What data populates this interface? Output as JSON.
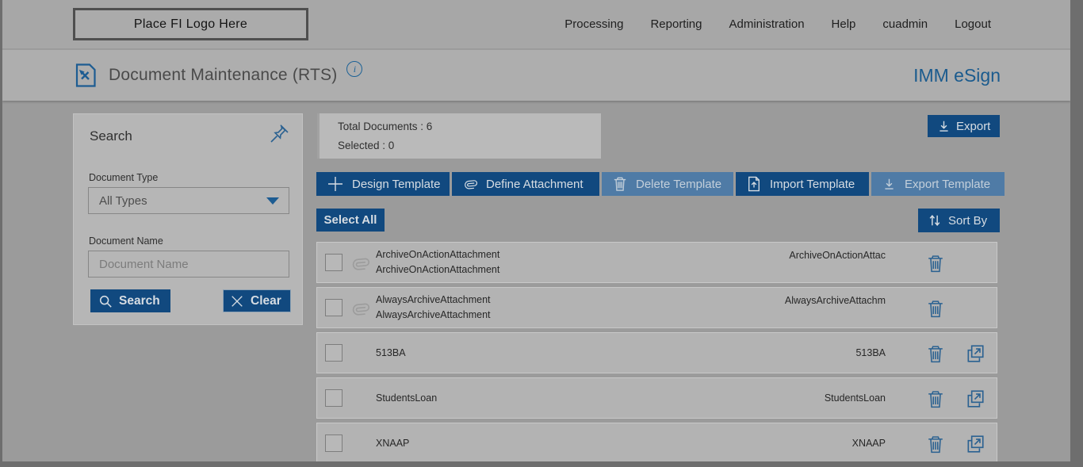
{
  "header": {
    "logo_placeholder": "Place FI Logo Here",
    "nav": [
      {
        "label": "Processing"
      },
      {
        "label": "Reporting"
      },
      {
        "label": "Administration"
      },
      {
        "label": "Help"
      },
      {
        "label": "cuadmin"
      },
      {
        "label": "Logout"
      }
    ]
  },
  "titlebar": {
    "title": "Document Maintenance (RTS)",
    "info_glyph": "i",
    "brand": "IMM eSign"
  },
  "search_panel": {
    "title": "Search",
    "document_type_label": "Document Type",
    "document_type_value": "All Types",
    "document_name_label": "Document Name",
    "document_name_placeholder": "Document Name",
    "document_name_value": "",
    "search_button": "Search",
    "clear_button": "Clear"
  },
  "summary": {
    "total_documents": "Total Documents : 6",
    "selected": "Selected : 0"
  },
  "actions": {
    "export_label": "Export",
    "select_all_label": "Select All",
    "sort_by_label": "Sort By",
    "toolbar": [
      {
        "label": "Design Template",
        "icon": "plus-icon",
        "enabled": true
      },
      {
        "label": "Define Attachment",
        "icon": "paperclip-icon",
        "enabled": true
      },
      {
        "label": "Delete Template",
        "icon": "trash-icon",
        "enabled": false
      },
      {
        "label": "Import Template",
        "icon": "import-icon",
        "enabled": true
      },
      {
        "label": "Export Template",
        "icon": "download-icon",
        "enabled": false
      }
    ]
  },
  "documents": {
    "rows": [
      {
        "name": "ArchiveOnActionAttachment",
        "subname": "ArchiveOnActionAttachment",
        "right_name": "ArchiveOnActionAttac",
        "attachment": true,
        "actions": [
          "delete"
        ]
      },
      {
        "name": "AlwaysArchiveAttachment",
        "subname": "AlwaysArchiveAttachment",
        "right_name": "AlwaysArchiveAttachm",
        "attachment": true,
        "actions": [
          "delete"
        ]
      },
      {
        "name": "513BA",
        "right_name": "513BA",
        "attachment": false,
        "actions": [
          "delete",
          "export"
        ]
      },
      {
        "name": "StudentsLoan",
        "right_name": "StudentsLoan",
        "attachment": false,
        "actions": [
          "delete",
          "export"
        ]
      },
      {
        "name": "XNAAP",
        "right_name": "XNAAP",
        "attachment": false,
        "actions": [
          "delete",
          "export"
        ]
      }
    ]
  },
  "colors": {
    "accent_navy": "#11497f",
    "disabled_navy": "#4f7ba6",
    "link_blue": "#1d5c92",
    "icon_blue": "#2a6191",
    "page_background": "#9b9b9b",
    "panel_background": "#b6b6b6"
  }
}
